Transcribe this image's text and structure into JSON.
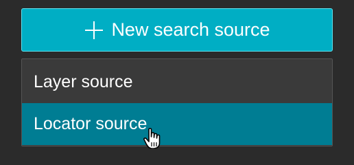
{
  "toolbar": {
    "new_source_label": "New search source"
  },
  "menu": {
    "items": [
      {
        "label": "Layer source"
      },
      {
        "label": "Locator source"
      }
    ],
    "highlighted_index": 1
  },
  "colors": {
    "accent": "#00aec4",
    "highlight": "#007d93",
    "background": "#2b2b2b",
    "menu_background": "#3a3a3a"
  },
  "icons": {
    "button_icon": "plus-icon",
    "pointer": "hand-pointer-icon"
  }
}
